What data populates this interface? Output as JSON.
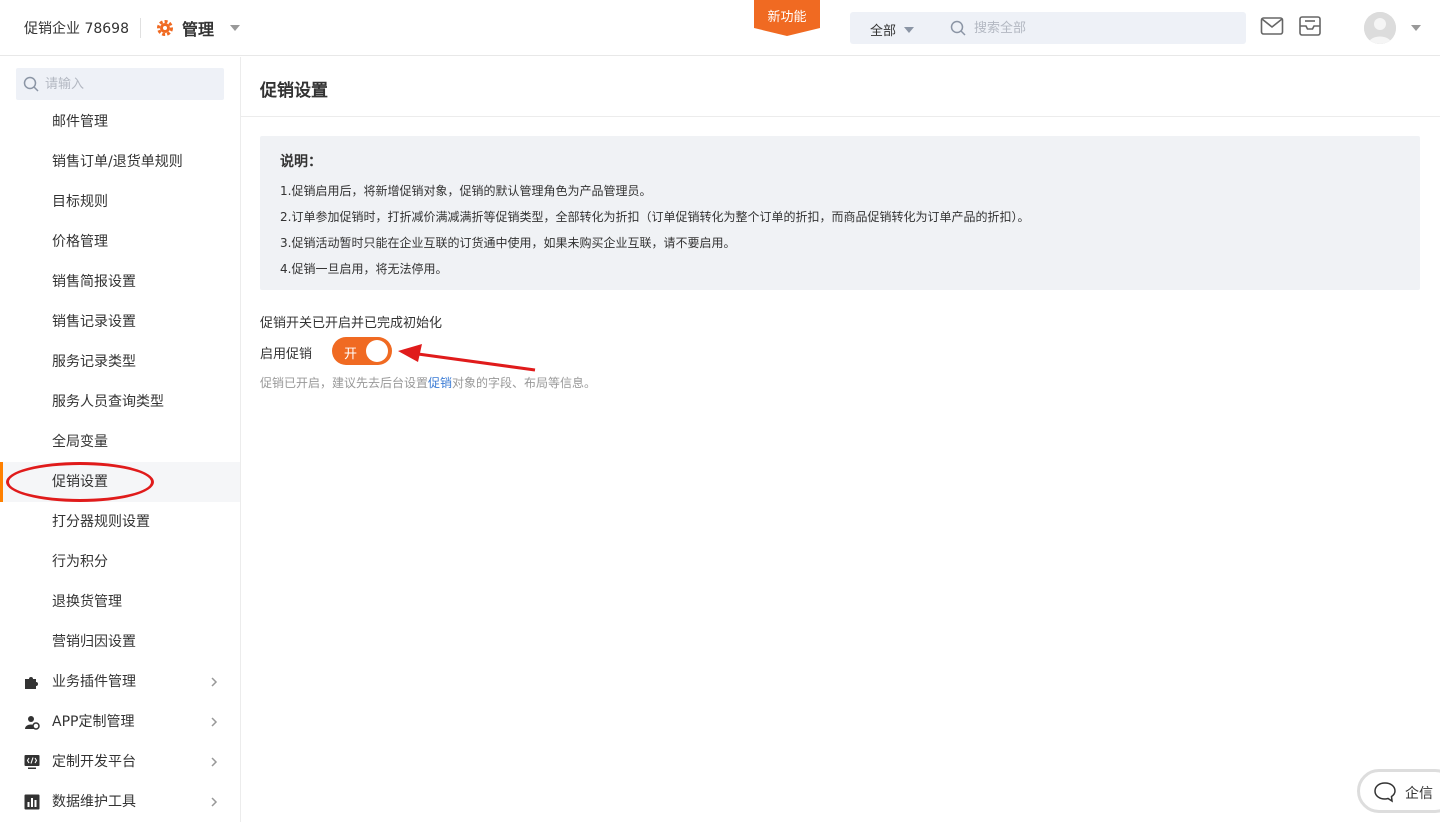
{
  "header": {
    "company": "促销企业 78698",
    "management": "管理",
    "new_feature": "新功能",
    "search_scope": "全部",
    "search_placeholder": "搜索全部"
  },
  "sidebar": {
    "search_placeholder": "请输入",
    "items": [
      {
        "label": "邮件管理"
      },
      {
        "label": "销售订单/退货单规则"
      },
      {
        "label": "目标规则"
      },
      {
        "label": "价格管理"
      },
      {
        "label": "销售简报设置"
      },
      {
        "label": "销售记录设置"
      },
      {
        "label": "服务记录类型"
      },
      {
        "label": "服务人员查询类型"
      },
      {
        "label": "全局变量"
      },
      {
        "label": "促销设置",
        "active": true
      },
      {
        "label": "打分器规则设置"
      },
      {
        "label": "行为积分"
      },
      {
        "label": "退换货管理"
      },
      {
        "label": "营销归因设置"
      }
    ],
    "groups": [
      {
        "label": "业务插件管理",
        "icon": "puzzle-icon"
      },
      {
        "label": "APP定制管理",
        "icon": "app-settings-icon"
      },
      {
        "label": "定制开发平台",
        "icon": "code-monitor-icon"
      },
      {
        "label": "数据维护工具",
        "icon": "bar-chart-icon"
      }
    ]
  },
  "main": {
    "title": "促销设置",
    "notice": {
      "title": "说明：",
      "lines": [
        "1.促销启用后，将新增促销对象，促销的默认管理角色为产品管理员。",
        "2.订单参加促销时，打折减价满减满折等促销类型，全部转化为折扣（订单促销转化为整个订单的折扣，而商品促销转化为订单产品的折扣）。",
        "3.促销活动暂时只能在企业互联的订货通中使用，如果未购买企业互联，请不要启用。",
        "4.促销一旦启用，将无法停用。"
      ]
    },
    "status": "促销开关已开启并已完成初始化",
    "enable_label": "启用促销",
    "toggle": {
      "text": "开",
      "on": true
    },
    "hint_before": "促销已开启，建议先去后台设置",
    "hint_link": "促销",
    "hint_after": "对象的字段、布局等信息。"
  },
  "float": {
    "label": "企信"
  },
  "colors": {
    "accent": "#f06a22",
    "annotation": "#e01b1b",
    "link": "#3a7bd5"
  }
}
